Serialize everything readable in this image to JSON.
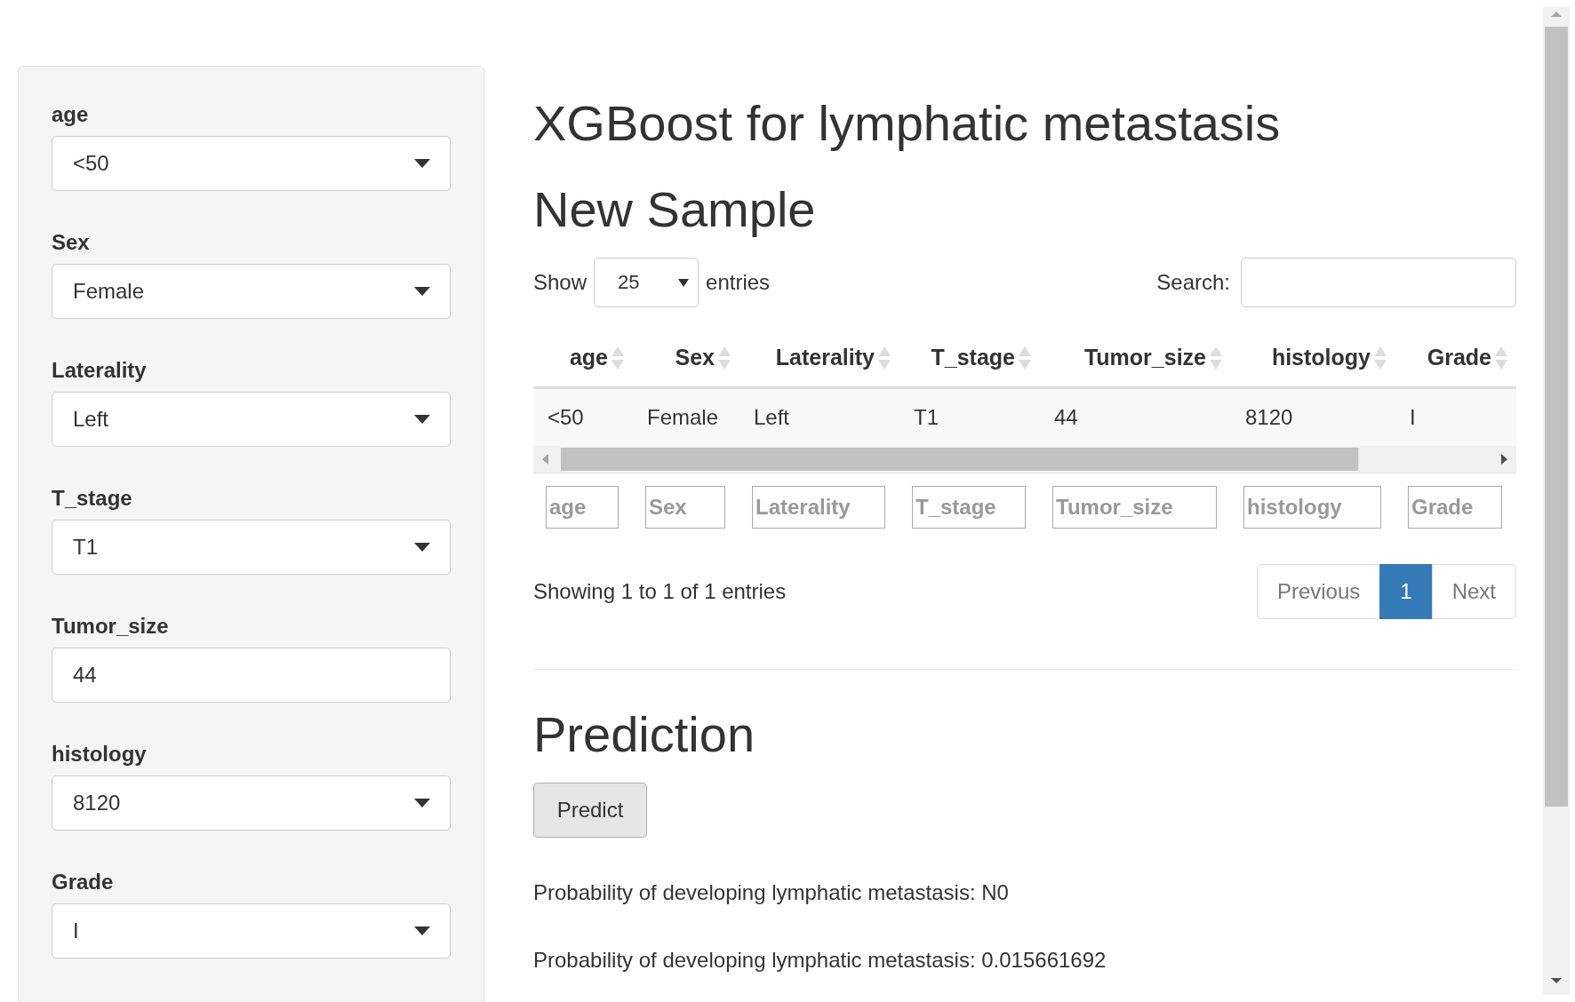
{
  "sidebar": {
    "inputs": [
      {
        "label": "age",
        "kind": "select",
        "value": "<50"
      },
      {
        "label": "Sex",
        "kind": "select",
        "value": "Female"
      },
      {
        "label": "Laterality",
        "kind": "select",
        "value": "Left"
      },
      {
        "label": "T_stage",
        "kind": "select",
        "value": "T1"
      },
      {
        "label": "Tumor_size",
        "kind": "text",
        "value": "44"
      },
      {
        "label": "histology",
        "kind": "select",
        "value": "8120"
      },
      {
        "label": "Grade",
        "kind": "select",
        "value": "I"
      }
    ]
  },
  "title": "XGBoost for lymphatic metastasis",
  "sample": {
    "heading": "New Sample",
    "show_label": "Show",
    "page_length": "25",
    "entries_label": "entries",
    "search_label": "Search:",
    "columns": [
      "age",
      "Sex",
      "Laterality",
      "T_stage",
      "Tumor_size",
      "histology",
      "Grade"
    ],
    "rows": [
      [
        "<50",
        "Female",
        "Left",
        "T1",
        "44",
        "8120",
        "I"
      ]
    ],
    "filters": [
      {
        "placeholder": "age"
      },
      {
        "placeholder": "Sex"
      },
      {
        "placeholder": "Laterality"
      },
      {
        "placeholder": "T_stage"
      },
      {
        "placeholder": "Tumor_size"
      },
      {
        "placeholder": "histology"
      },
      {
        "placeholder": "Grade"
      }
    ],
    "info": "Showing 1 to 1 of 1 entries",
    "pagination": [
      {
        "label": "Previous",
        "selected": false
      },
      {
        "label": "1",
        "selected": true
      },
      {
        "label": "Next",
        "selected": false
      }
    ]
  },
  "prediction": {
    "heading": "Prediction",
    "button": "Predict",
    "outputs": [
      "Probability of developing lymphatic metastasis: N0",
      "Probability of developing lymphatic metastasis: 0.015661692"
    ]
  }
}
